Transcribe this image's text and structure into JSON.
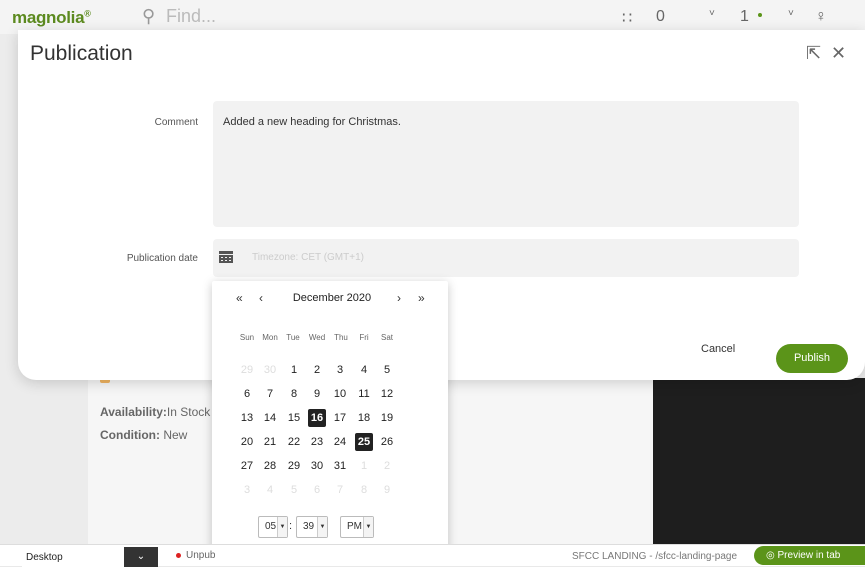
{
  "app": {
    "logo": "magnolia",
    "search_placeholder": "Find..."
  },
  "topbar": {
    "grid_icon": "∷",
    "counter_a": "0",
    "counter_b": "1",
    "chevron": "˅",
    "user_icon": "♀"
  },
  "background": {
    "availability_label": "Availability:",
    "availability_value": "In Stock",
    "condition_label": "Condition:",
    "condition_value": "New"
  },
  "dialog": {
    "title": "Publication",
    "comment_label": "Comment",
    "comment_value": "Added a new heading for Christmas.",
    "date_label": "Publication date",
    "date_placeholder": "Timezone: CET (GMT+1)",
    "cancel_label": "Cancel",
    "publish_label": "Publish"
  },
  "calendar": {
    "month_label": "December 2020",
    "nav_prev_year": "«",
    "nav_prev_month": "‹",
    "nav_next_month": "›",
    "nav_next_year": "»",
    "weekdays": [
      "Sun",
      "Mon",
      "Tue",
      "Wed",
      "Thu",
      "Fri",
      "Sat"
    ],
    "weeks": [
      [
        "29",
        "30",
        "1",
        "2",
        "3",
        "4",
        "5"
      ],
      [
        "6",
        "7",
        "8",
        "9",
        "10",
        "11",
        "12"
      ],
      [
        "13",
        "14",
        "15",
        "16",
        "17",
        "18",
        "19"
      ],
      [
        "20",
        "21",
        "22",
        "23",
        "24",
        "25",
        "26"
      ],
      [
        "27",
        "28",
        "29",
        "30",
        "31",
        "1",
        "2"
      ],
      [
        "3",
        "4",
        "5",
        "6",
        "7",
        "8",
        "9"
      ]
    ],
    "hour": "05",
    "minute": "39",
    "ampm": "PM"
  },
  "footer": {
    "device": "Desktop",
    "status": "Unpub",
    "page_path": "SFCC LANDING - /sfcc-landing-page",
    "preview_label": "Preview in tab"
  }
}
